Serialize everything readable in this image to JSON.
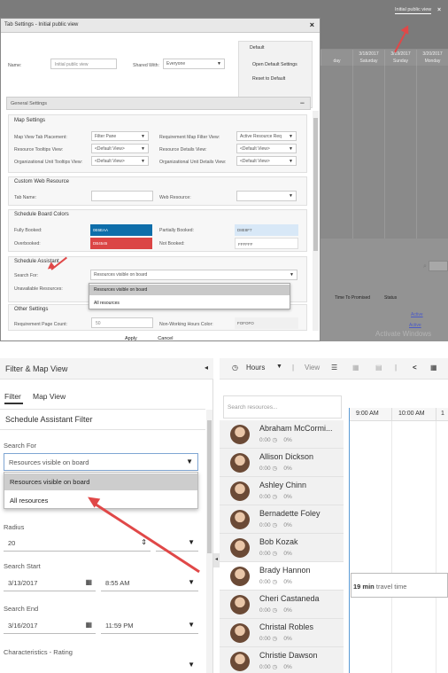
{
  "top": {
    "tab_label": "Initial public view",
    "background_close": "×",
    "calendar_days": [
      {
        "date": "",
        "day": "day"
      },
      {
        "date": "3/18/2017",
        "day": "Saturday"
      },
      {
        "date": "3/19/2017",
        "day": "Sunday"
      },
      {
        "date": "3/20/2017",
        "day": "Monday"
      }
    ],
    "col_headers": [
      "Time To Promised",
      "Status"
    ],
    "status_links": [
      "Active",
      "Active"
    ],
    "watermark": "Activate Windows",
    "dialog": {
      "title": "Tab Settings - Initial public view",
      "close": "×",
      "name_label": "Name:",
      "name_value": "Initial public view",
      "shared_with_label": "Shared With:",
      "shared_with_value": "Everyone",
      "default_title": "Default",
      "open_default": "Open Default Settings",
      "reset_default": "Reset to Default",
      "general_settings": "General Settings",
      "collapse": "−",
      "map_settings": {
        "title": "Map Settings",
        "rows": [
          {
            "label": "Map View Tab Placement:",
            "value": "Filter Pane",
            "label2": "Requirement Map Filter View:",
            "value2": "Active Resource Req"
          },
          {
            "label": "Resource Tooltips View:",
            "value": "<Default View>",
            "label2": "Resource Details View:",
            "value2": "<Default View>"
          },
          {
            "label": "Organizational Unit Tooltips View:",
            "value": "<Default View>",
            "label2": "Organizational Unit Details View:",
            "value2": "<Default View>"
          }
        ]
      },
      "custom_web": {
        "title": "Custom Web Resource",
        "tab_name_label": "Tab Name:",
        "web_resource_label": "Web Resource:"
      },
      "board_colors": {
        "title": "Schedule Board Colors",
        "fully_booked_label": "Fully Booked:",
        "fully_booked_value": "0E6EAA",
        "fully_booked_color": "#0e6eaa",
        "partially_booked_label": "Partially Booked:",
        "partially_booked_value": "D8E8F7",
        "partially_booked_color": "#d8e8f7",
        "overbooked_label": "Overbooked:",
        "overbooked_value": "DB4545",
        "overbooked_color": "#db4545",
        "not_booked_label": "Not Booked:",
        "not_booked_value": "FFFFFF"
      },
      "schedule_assistant": {
        "title": "Schedule Assistant",
        "search_for_label": "Search For:",
        "search_for_value": "Resources visible on board",
        "unavailable_label": "Unavailable Resources:",
        "options": [
          "Resources visible on board",
          "All resources"
        ]
      },
      "other_settings": {
        "title": "Other Settings",
        "req_page_count_label": "Requirement Page Count:",
        "req_page_count_value": "50",
        "non_working_label": "Non-Working Hours Color:",
        "non_working_value": "FOFOFO"
      },
      "apply": "Apply",
      "cancel": "Cancel"
    }
  },
  "bottom": {
    "left": {
      "title": "Filter & Map View",
      "collapse_icon": "◂",
      "tabs": [
        "Filter",
        "Map View"
      ],
      "section_title": "Schedule Assistant Filter",
      "search_for_label": "Search For",
      "search_for_value": "Resources visible on board",
      "options": [
        "Resources visible on board",
        "All resources"
      ],
      "radius_label": "Radius",
      "radius_value": "20",
      "search_start_label": "Search Start",
      "search_start_date": "3/13/2017",
      "search_start_time": "8:55 AM",
      "search_end_label": "Search End",
      "search_end_date": "3/16/2017",
      "search_end_time": "11:59 PM",
      "characteristics_label": "Characteristics - Rating"
    },
    "right": {
      "toolbar": {
        "hours": "Hours",
        "view": "View"
      },
      "search_placeholder": "Search resources...",
      "time_headers": [
        "9:00 AM",
        "10:00 AM",
        "1"
      ],
      "resources": [
        {
          "name": "Abraham McCormi...",
          "hours": "0:00",
          "pct": "0%"
        },
        {
          "name": "Allison Dickson",
          "hours": "0:00",
          "pct": "0%"
        },
        {
          "name": "Ashley Chinn",
          "hours": "0:00",
          "pct": "0%"
        },
        {
          "name": "Bernadette Foley",
          "hours": "0:00",
          "pct": "0%"
        },
        {
          "name": "Bob Kozak",
          "hours": "0:00",
          "pct": "0%"
        },
        {
          "name": "Brady Hannon",
          "hours": "0:00",
          "pct": "0%"
        },
        {
          "name": "Cheri Castaneda",
          "hours": "0:00",
          "pct": "0%"
        },
        {
          "name": "Christal Robles",
          "hours": "0:00",
          "pct": "0%"
        },
        {
          "name": "Christie Dawson",
          "hours": "0:00",
          "pct": "0%"
        }
      ],
      "travel_time_bold": "19 min",
      "travel_time_text": "travel time"
    }
  },
  "colors": {
    "arrow": "#e04848",
    "now_line": "#5b9bd5"
  }
}
